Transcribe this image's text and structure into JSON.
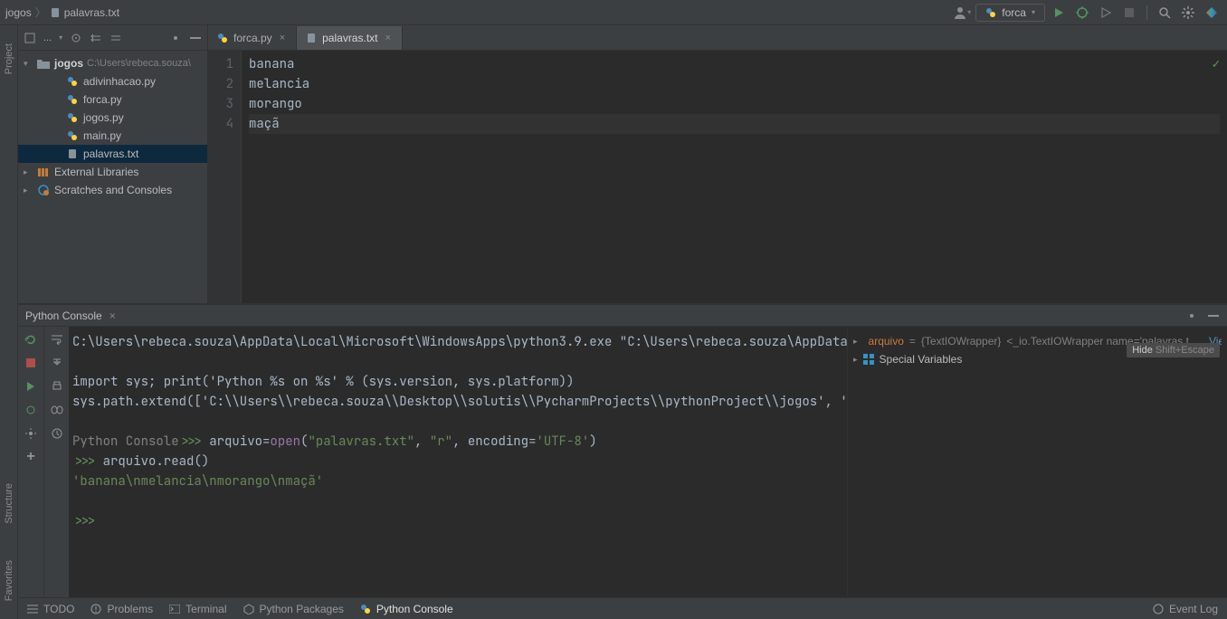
{
  "breadcrumb": [
    "jogos",
    "palavras.txt"
  ],
  "runConfig": {
    "name": "forca"
  },
  "projectTree": {
    "root": {
      "name": "jogos",
      "path": "C:\\Users\\rebeca.souza\\"
    },
    "files": [
      "adivinhacao.py",
      "forca.py",
      "jogos.py",
      "main.py",
      "palavras.txt"
    ],
    "selected": "palavras.txt",
    "external": "External Libraries",
    "scratches": "Scratches and Consoles"
  },
  "editorTabs": [
    {
      "label": "forca.py",
      "active": false
    },
    {
      "label": "palavras.txt",
      "active": true
    }
  ],
  "editor": {
    "lines": [
      "banana",
      "melancia",
      "morango",
      "maçã"
    ],
    "currentLine": 4
  },
  "console": {
    "title": "Python Console",
    "output": {
      "interp": "C:\\Users\\rebeca.souza\\AppData\\Local\\Microsoft\\WindowsApps\\python3.9.exe \"C:\\Users\\rebeca.souza\\AppData\\Loca",
      "importLine": "import sys; print('Python %s on %s' % (sys.version, sys.platform))",
      "pathLine": "sys.path.extend(['C:\\\\Users\\\\rebeca.souza\\\\Desktop\\\\solutis\\\\PycharmProjects\\\\pythonProject\\\\jogos', 'C:/Us",
      "pcLabel": "Python Console",
      "cmd1_pre": "arquivo=open(",
      "cmd1_arg1": "\"palavras.txt\"",
      "cmd1_arg2": "\"r\"",
      "cmd1_kw": "encoding=",
      "cmd1_arg3": "'UTF-8'",
      "cmd2": "arquivo.read()",
      "result": "'banana\\nmelancia\\nmorango\\nmaçã'"
    },
    "vars": {
      "v1": {
        "name": "arquivo",
        "typ": "{TextIOWrapper}",
        "suffix": "<_io.TextIOWrapper name='palavras.t",
        "view": "View"
      },
      "v2": "Special Variables"
    },
    "hideHint": {
      "label": "Hide",
      "shortcut": "Shift+Escape"
    }
  },
  "bottomTabs": {
    "todo": "TODO",
    "problems": "Problems",
    "terminal": "Terminal",
    "pkgs": "Python Packages",
    "console": "Python Console",
    "eventlog": "Event Log"
  },
  "leftRail": {
    "project": "Project",
    "structure": "Structure",
    "favorites": "Favorites"
  }
}
